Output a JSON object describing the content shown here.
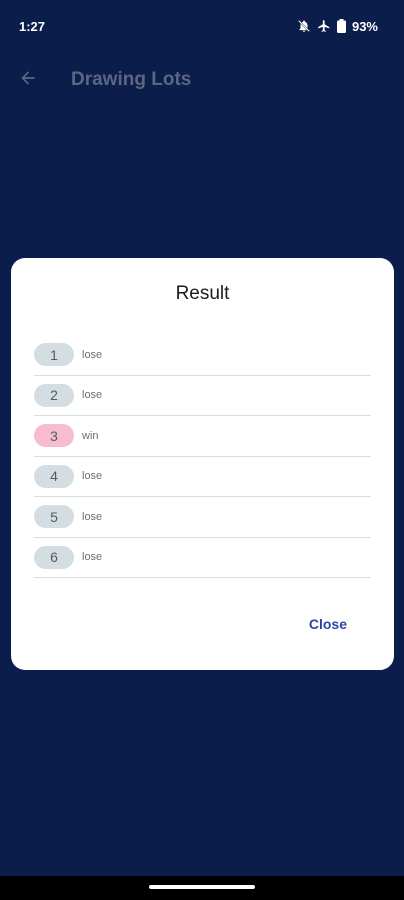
{
  "status_bar": {
    "time": "1:27",
    "battery": "93%",
    "icons": [
      "notifications-off-icon",
      "airplane-mode-icon",
      "battery-icon"
    ]
  },
  "app_bar": {
    "title": "Drawing Lots",
    "back_icon": "arrow-back-icon"
  },
  "dialog": {
    "title": "Result",
    "results": [
      {
        "number": "1",
        "outcome": "lose"
      },
      {
        "number": "2",
        "outcome": "lose"
      },
      {
        "number": "3",
        "outcome": "win"
      },
      {
        "number": "4",
        "outcome": "lose"
      },
      {
        "number": "5",
        "outcome": "lose"
      },
      {
        "number": "6",
        "outcome": "lose"
      }
    ],
    "close_label": "Close"
  },
  "colors": {
    "background": "#0b1d4a",
    "lose_chip": "#d4dde1",
    "win_chip": "#f7bcd0",
    "accent": "#2b46a3"
  }
}
